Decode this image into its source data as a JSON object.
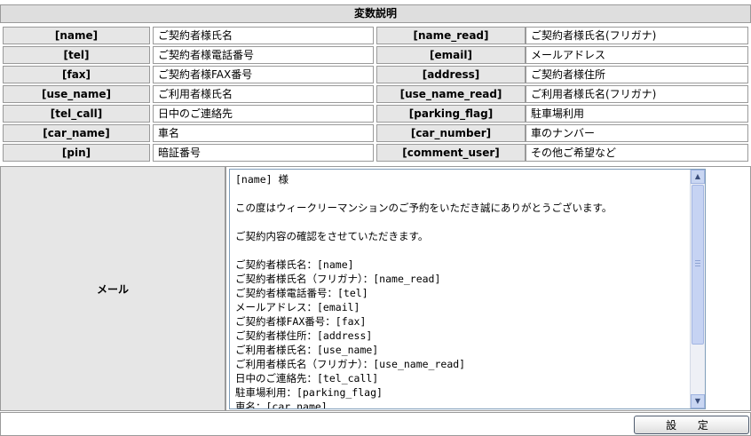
{
  "section_title": "変数説明",
  "variables": [
    {
      "key1": "[name]",
      "val1": "ご契約者様氏名",
      "key2": "[name_read]",
      "val2": "ご契約者様氏名(フリガナ)"
    },
    {
      "key1": "[tel]",
      "val1": "ご契約者様電話番号",
      "key2": "[email]",
      "val2": "メールアドレス"
    },
    {
      "key1": "[fax]",
      "val1": "ご契約者様FAX番号",
      "key2": "[address]",
      "val2": "ご契約者様住所"
    },
    {
      "key1": "[use_name]",
      "val1": "ご利用者様氏名",
      "key2": "[use_name_read]",
      "val2": "ご利用者様氏名(フリガナ)"
    },
    {
      "key1": "[tel_call]",
      "val1": "日中のご連絡先",
      "key2": "[parking_flag]",
      "val2": "駐車場利用"
    },
    {
      "key1": "[car_name]",
      "val1": "車名",
      "key2": "[car_number]",
      "val2": "車のナンバー"
    },
    {
      "key1": "[pin]",
      "val1": "暗証番号",
      "key2": "[comment_user]",
      "val2": "その他ご希望など"
    }
  ],
  "mail": {
    "label": "メール",
    "body": "[name] 様\n\nこの度はウィークリーマンションのご予約をいただき誠にありがとうございます。\n\nご契約内容の確認をさせていただきます。\n\nご契約者様氏名：[name]\nご契約者様氏名（フリガナ）：[name_read]\nご契約者様電話番号：[tel]\nメールアドレス：[email]\nご契約者様FAX番号：[fax]\nご契約者様住所：[address]\nご利用者様氏名：[use_name]\nご利用者様氏名（フリガナ）：[use_name_read]\n日中のご連絡先：[tel_call]\n駐車場利用：[parking_flag]\n車名：[car_name]",
    "scroll_up_icon": "arrow-up-icon",
    "scroll_down_icon": "arrow-down-icon"
  },
  "footer": {
    "submit_label": "設 定"
  }
}
